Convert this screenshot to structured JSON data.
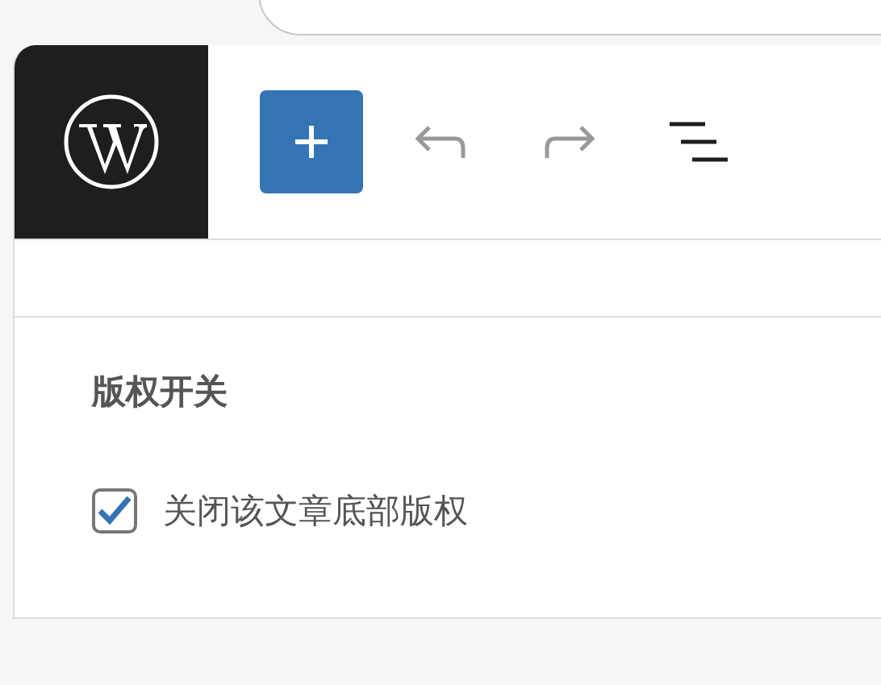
{
  "toolbar": {
    "buttons": [
      {
        "kind": "add",
        "selected": true
      },
      {
        "kind": "undo",
        "disabled": true
      },
      {
        "kind": "redo",
        "disabled": true
      },
      {
        "kind": "list",
        "selected": false
      }
    ]
  },
  "panels": [
    {
      "title": "版权开关",
      "options": [
        {
          "label": "关闭该文章底部版权",
          "checked": true
        }
      ]
    }
  ]
}
